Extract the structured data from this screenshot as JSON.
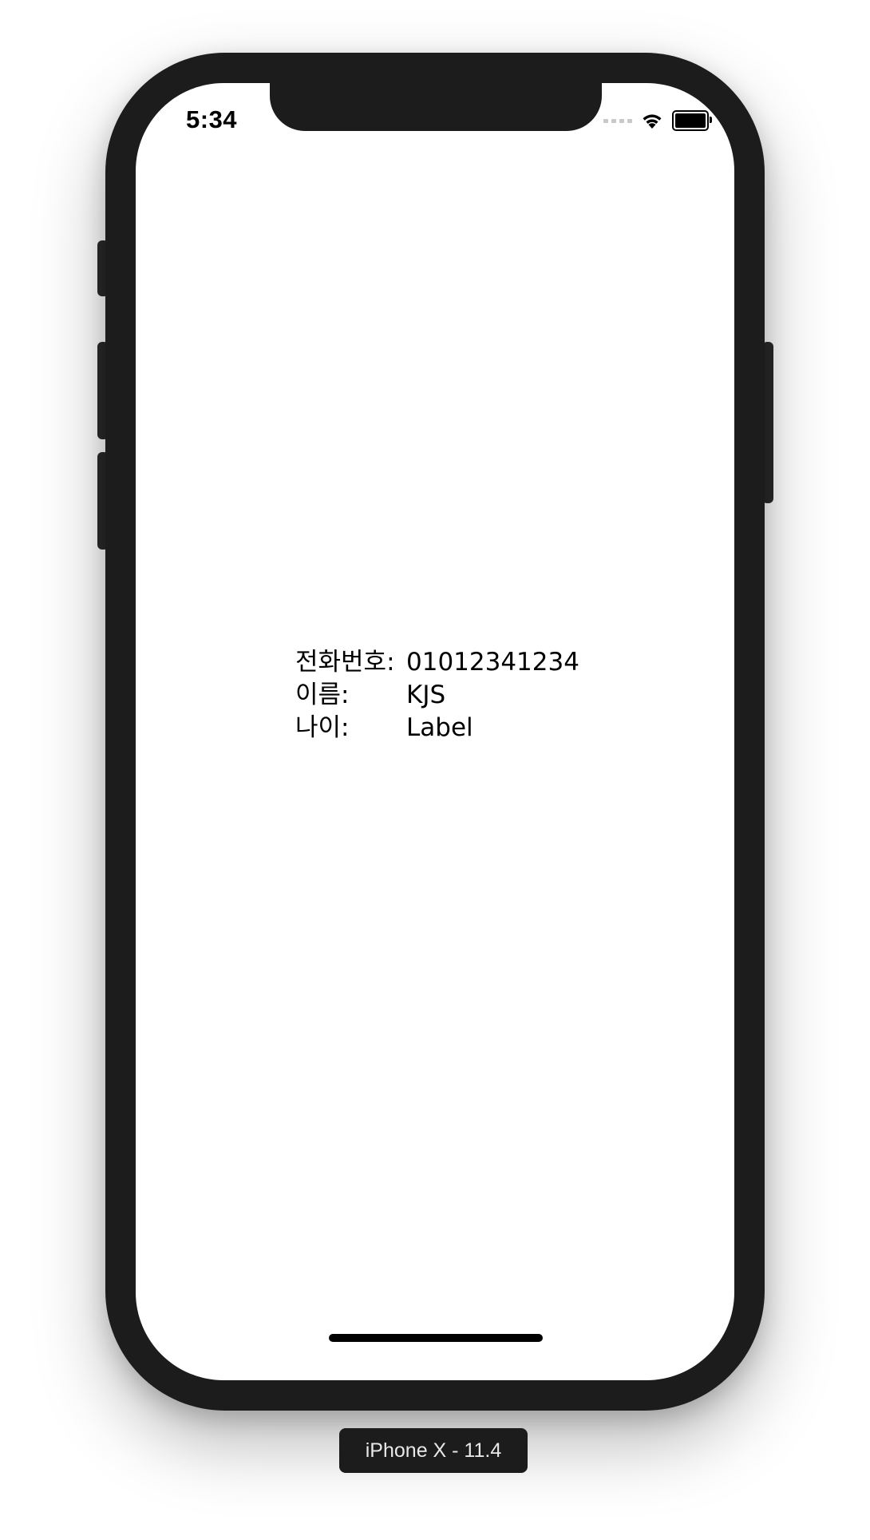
{
  "status_bar": {
    "time": "5:34",
    "icons": [
      "cellular-signal-icon",
      "wifi-icon",
      "battery-icon"
    ]
  },
  "info": {
    "rows": [
      {
        "label": "전화번호:",
        "value": "01012341234"
      },
      {
        "label": "이름:",
        "value": "KJS"
      },
      {
        "label": "나이:",
        "value": "Label"
      }
    ]
  },
  "simulator": {
    "device_label": "iPhone X - 11.4"
  },
  "colors": {
    "device_frame": "#1c1c1c",
    "screen_background": "#ffffff",
    "text": "#000000"
  }
}
